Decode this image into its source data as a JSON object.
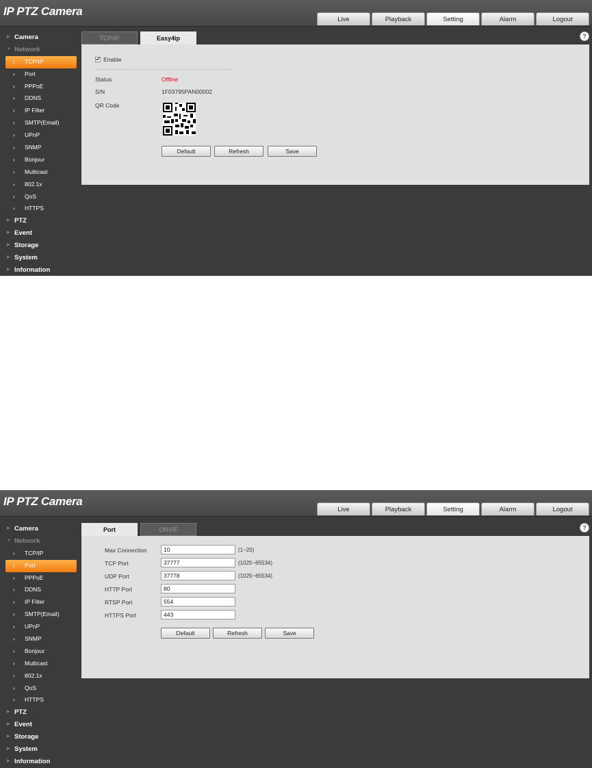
{
  "app": {
    "title": "IP PTZ Camera"
  },
  "nav": [
    "Live",
    "Playback",
    "Setting",
    "Alarm",
    "Logout"
  ],
  "nav_active": "Setting",
  "help_icon": "?",
  "sidebar": {
    "top": [
      "Camera",
      "Network"
    ],
    "network_sub": [
      "TCP/IP",
      "Port",
      "PPPoE",
      "DDNS",
      "IP Filter",
      "SMTP(Email)",
      "UPnP",
      "SNMP",
      "Bonjour",
      "Multicast",
      "802.1x",
      "QoS",
      "HTTPS"
    ],
    "bottom": [
      "PTZ",
      "Event",
      "Storage",
      "System",
      "Information"
    ]
  },
  "screen1": {
    "active_sub": "TCP/IP",
    "tabs": [
      "TCP/IP",
      "Easy4ip"
    ],
    "active_tab": "Easy4ip",
    "enable_label": "Enable",
    "enable_checked": "✔",
    "status_label": "Status",
    "status_value": "Offline",
    "sn_label": "S/N",
    "sn_value": "1F03795PAN00002",
    "qr_label": "QR Code",
    "buttons": [
      "Default",
      "Refresh",
      "Save"
    ]
  },
  "screen2": {
    "active_sub": "Port",
    "tabs": [
      "Port",
      "ONVIF"
    ],
    "active_tab": "Port",
    "fields": [
      {
        "label": "Max Connection",
        "value": "10",
        "range": "(1~20)"
      },
      {
        "label": "TCP Port",
        "value": "37777",
        "range": "(1025~65534)"
      },
      {
        "label": "UDP Port",
        "value": "37778",
        "range": "(1025~65534)"
      },
      {
        "label": "HTTP Port",
        "value": "80",
        "range": ""
      },
      {
        "label": "RTSP Port",
        "value": "554",
        "range": ""
      },
      {
        "label": "HTTPS Port",
        "value": "443",
        "range": ""
      }
    ],
    "buttons": [
      "Default",
      "Refresh",
      "Save"
    ]
  },
  "colors": {
    "accent": "#f07a10",
    "status_offline": "#e0001a",
    "bg_dark": "#3b3b3b",
    "panel": "#e0e0e0"
  }
}
